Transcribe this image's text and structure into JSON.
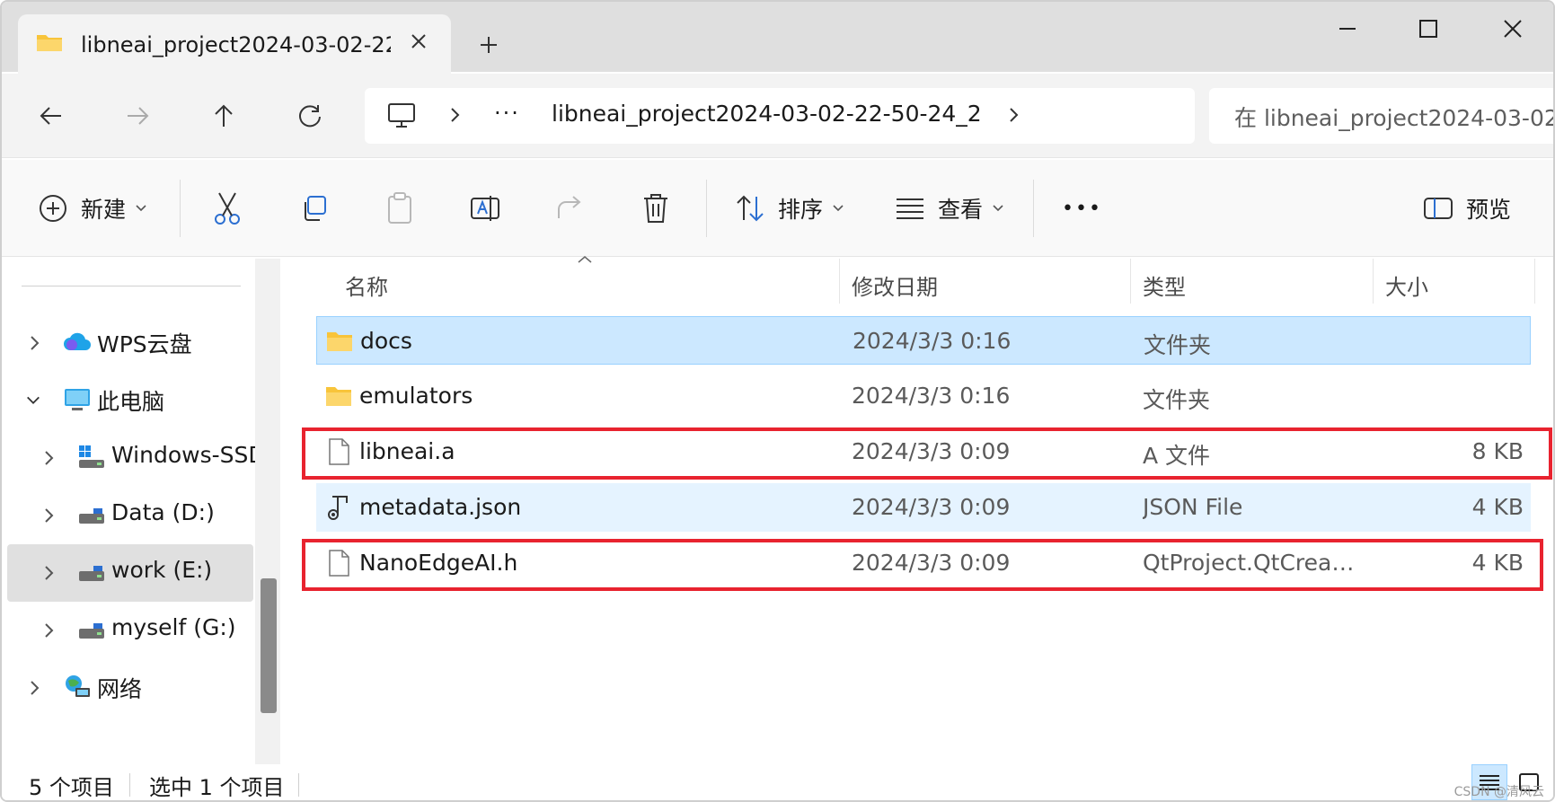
{
  "tab": {
    "title": "libneai_project2024-03-02-22-"
  },
  "address": {
    "overflow": "···",
    "crumb": "libneai_project2024-03-02-22-50-24_2"
  },
  "search": {
    "placeholder": "在 libneai_project2024-03-02"
  },
  "commands": {
    "new": "新建",
    "sort": "排序",
    "view": "查看",
    "more": "•••",
    "preview": "预览"
  },
  "sidebar": {
    "items": [
      {
        "label": "WPS云盘"
      },
      {
        "label": "此电脑"
      },
      {
        "label": "Windows-SSD"
      },
      {
        "label": "Data (D:)"
      },
      {
        "label": "work (E:)"
      },
      {
        "label": "myself (G:)"
      },
      {
        "label": "网络"
      }
    ]
  },
  "columns": {
    "name": "名称",
    "date": "修改日期",
    "type": "类型",
    "size": "大小"
  },
  "files": [
    {
      "name": "docs",
      "date": "2024/3/3 0:16",
      "type": "文件夹",
      "size": ""
    },
    {
      "name": "emulators",
      "date": "2024/3/3 0:16",
      "type": "文件夹",
      "size": ""
    },
    {
      "name": "libneai.a",
      "date": "2024/3/3 0:09",
      "type": "A 文件",
      "size": "8 KB"
    },
    {
      "name": "metadata.json",
      "date": "2024/3/3 0:09",
      "type": "JSON File",
      "size": "4 KB"
    },
    {
      "name": "NanoEdgeAI.h",
      "date": "2024/3/3 0:09",
      "type": "QtProject.QtCreato...",
      "size": "4 KB"
    }
  ],
  "status": {
    "count": "5 个项目",
    "selected": "选中 1 个项目"
  },
  "watermark": "CSDN @清风云",
  "colors": {
    "selection": "#cce8ff",
    "highlight_box": "#e8232f",
    "folder": "#f8c43a"
  }
}
